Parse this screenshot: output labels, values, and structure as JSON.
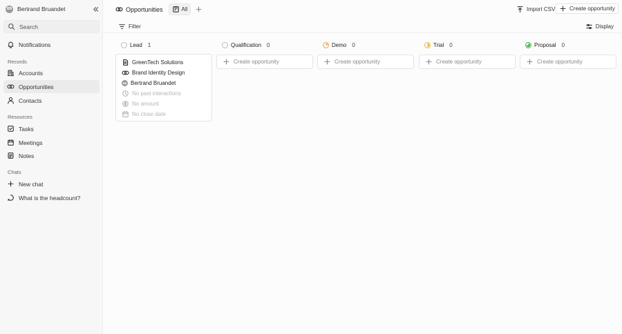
{
  "sidebar": {
    "workspace": {
      "initials": "BB",
      "name": "Bertrand Bruandet"
    },
    "search": {
      "label": "Search"
    },
    "notifications": {
      "label": "Notifications"
    },
    "sections": {
      "records": "Records",
      "resources": "Resources",
      "chats": "Chats"
    },
    "records": [
      {
        "label": "Accounts",
        "icon": "building-icon"
      },
      {
        "label": "Opportunities",
        "icon": "handshake-icon",
        "active": true
      },
      {
        "label": "Contacts",
        "icon": "user-icon"
      }
    ],
    "resources": [
      {
        "label": "Tasks",
        "icon": "checkbox-icon"
      },
      {
        "label": "Meetings",
        "icon": "calendar-icon"
      },
      {
        "label": "Notes",
        "icon": "note-icon"
      }
    ],
    "chats": [
      {
        "label": "New chat",
        "icon": "plus-icon"
      },
      {
        "label": "What is the headcount?",
        "icon": "chat-bubble-icon"
      }
    ]
  },
  "header": {
    "title": "Opportunities",
    "view_tab": "All",
    "import_label": "Import CSV",
    "create_label": "Create opportunity",
    "filter_label": "Filter",
    "display_label": "Display"
  },
  "board": {
    "columns": [
      {
        "name": "Lead",
        "count": "1",
        "color": "#bdbdbd"
      },
      {
        "name": "Qualification",
        "count": "0",
        "color": "#bdbdbd",
        "create": "Create opportunity"
      },
      {
        "name": "Demo",
        "count": "0",
        "color": "#e8a33a",
        "create": "Create opportunity"
      },
      {
        "name": "Trial",
        "count": "0",
        "color": "#e8b53a",
        "create": "Create opportunity"
      },
      {
        "name": "Proposal",
        "count": "0",
        "color": "#4caf50",
        "create": "Create opportunity"
      }
    ],
    "card": {
      "company": "GreenTech Solutions",
      "opportunity": "Brand Identity Design",
      "owner_initials": "BB",
      "owner": "Bertrand Bruandet",
      "interactions": "No past interactions",
      "amount": "No amount",
      "close_date": "No close date"
    }
  }
}
